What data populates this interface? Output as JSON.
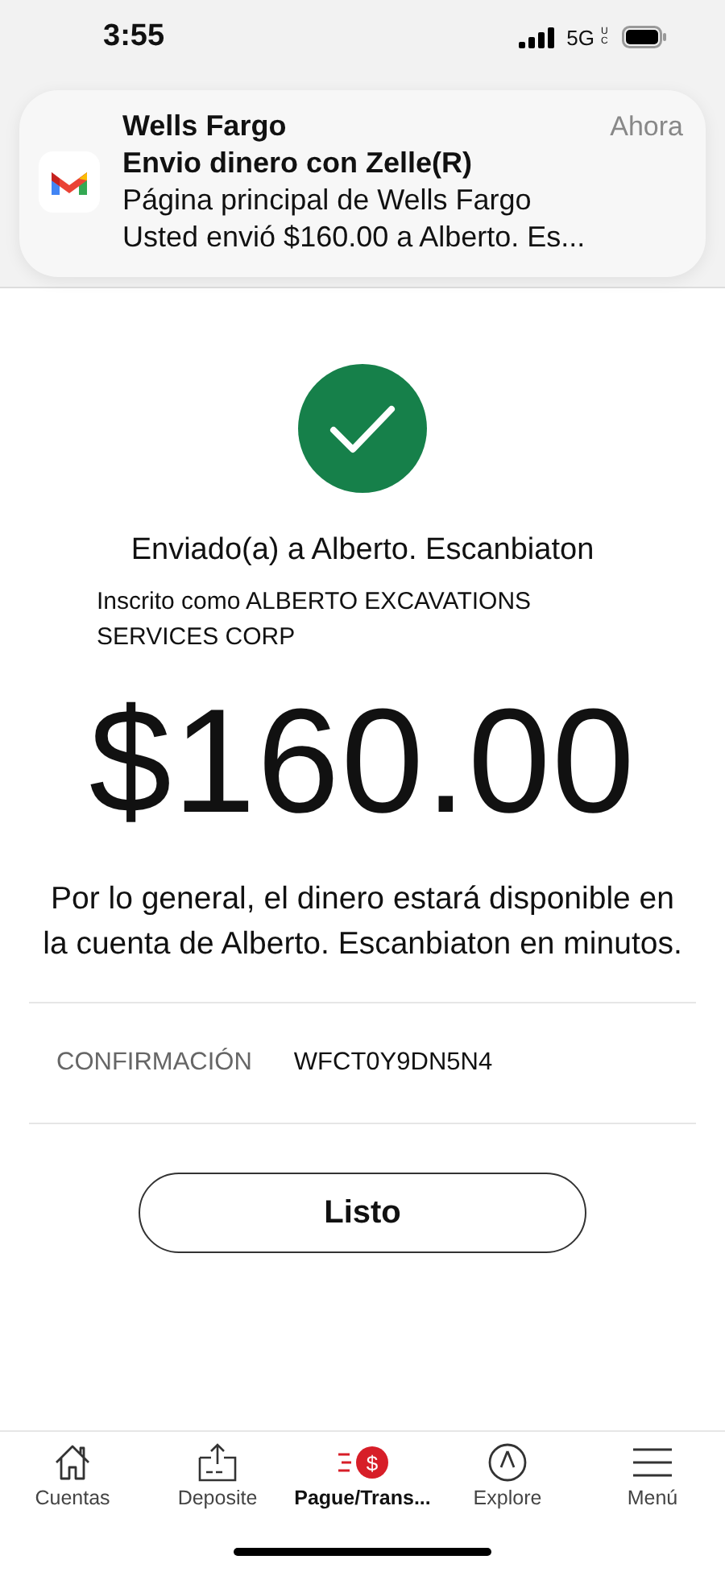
{
  "status_bar": {
    "time": "3:55",
    "network": "5G",
    "network_sub": "UC"
  },
  "notification": {
    "app": "Wells Fargo",
    "time": "Ahora",
    "title": "Envio dinero con Zelle(R)",
    "subtitle": "Página principal de Wells Fargo",
    "body": "Usted envió $160.00 a Alberto. Es..."
  },
  "confirmation": {
    "recipient": "Enviado(a) a Alberto. Escanbiaton",
    "enrolled_as": "Inscrito como ALBERTO EXCAVATIONS SERVICES CORP",
    "amount": "$160.00",
    "message": "Por lo general, el dinero estará disponible en la cuenta de Alberto. Escanbiaton en minutos.",
    "detail_label": "CONFIRMACIÓN",
    "detail_value": "WFCT0Y9DN5N4",
    "done_button": "Listo"
  },
  "tab_bar": [
    {
      "kind": "home",
      "label": "Cuentas",
      "selected": false
    },
    {
      "kind": "deposit",
      "label": "Deposite",
      "selected": false
    },
    {
      "kind": "pay",
      "glyph": "$",
      "label": "Pague/Trans...",
      "selected": true
    },
    {
      "kind": "explore",
      "label": "Explore",
      "selected": false
    },
    {
      "kind": "menu",
      "label": "Menú",
      "selected": false
    }
  ]
}
